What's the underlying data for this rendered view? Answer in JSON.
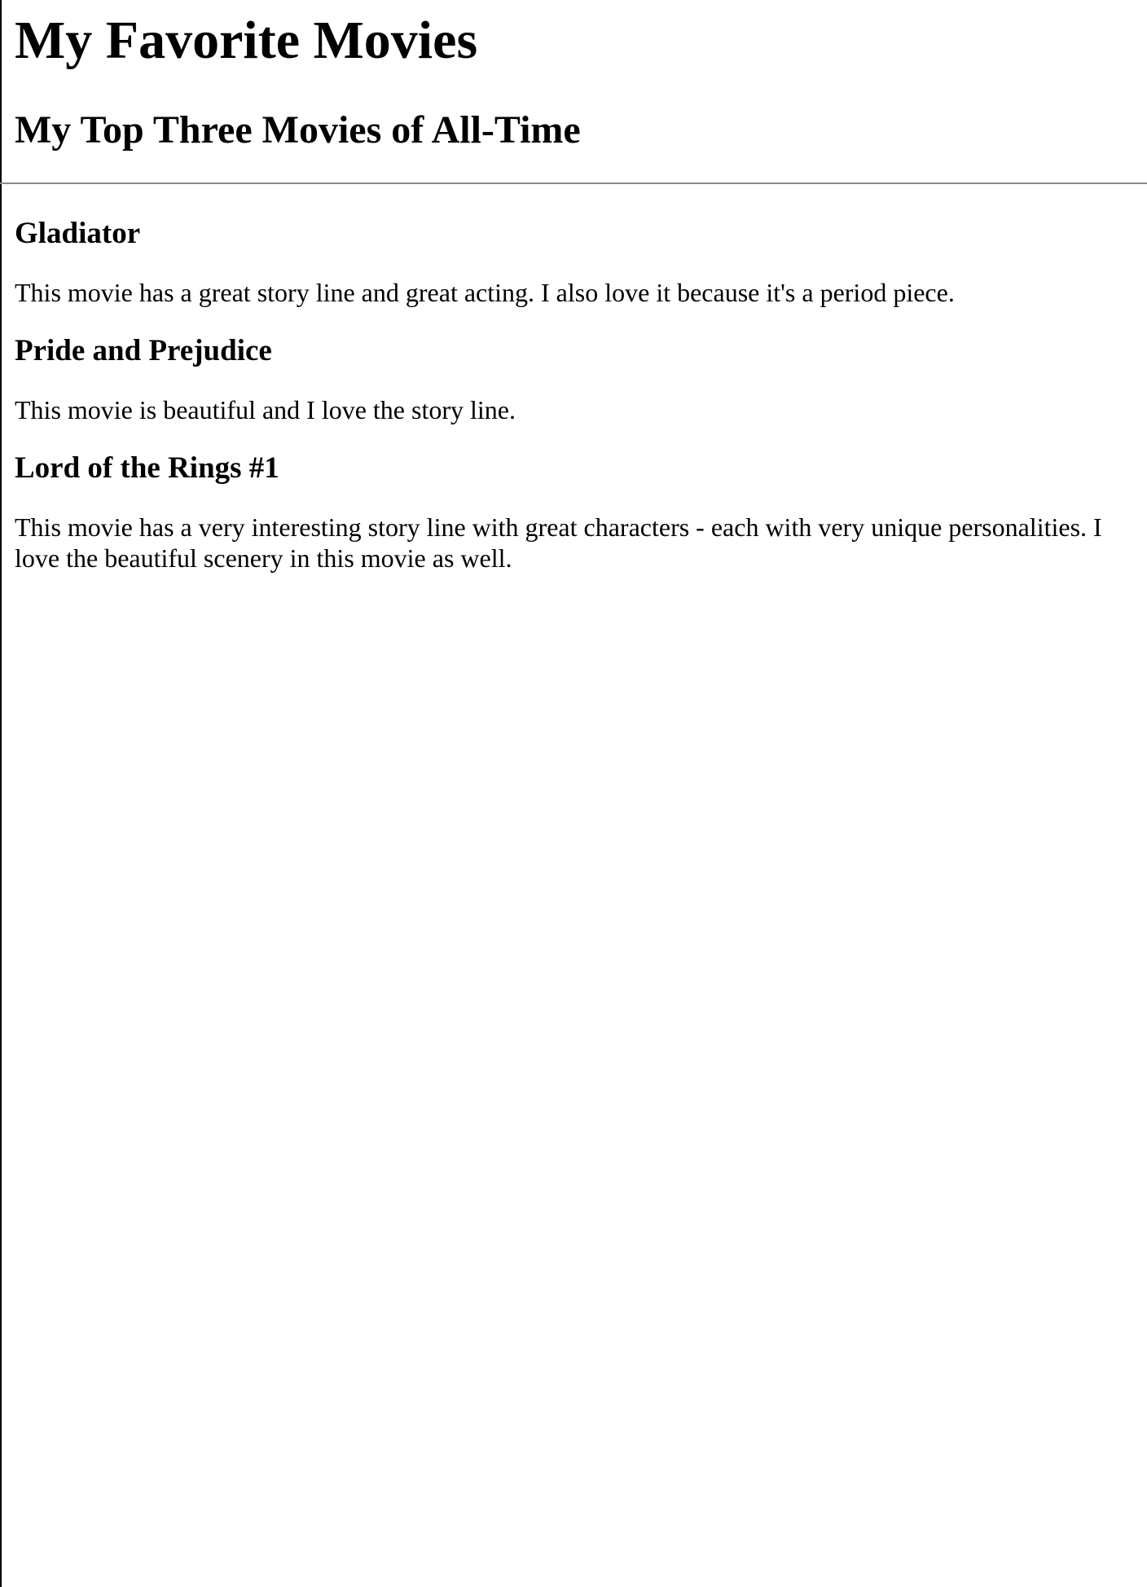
{
  "page": {
    "title": "My Favorite Movies",
    "subtitle": "My Top Three Movies of All-Time"
  },
  "movies": [
    {
      "title": "Gladiator",
      "description": "This movie has a great story line and great acting. I also love it because it's a period piece."
    },
    {
      "title": "Pride and Prejudice",
      "description": "This movie is beautiful and I love the story line."
    },
    {
      "title": "Lord of the Rings #1",
      "description": "This movie has a very interesting story line with great characters - each with very unique personalities. I love the beautiful scenery in this movie as well."
    }
  ],
  "colors": {
    "text": "#000000",
    "background": "#ffffff",
    "divider": "#8a8a8a"
  }
}
